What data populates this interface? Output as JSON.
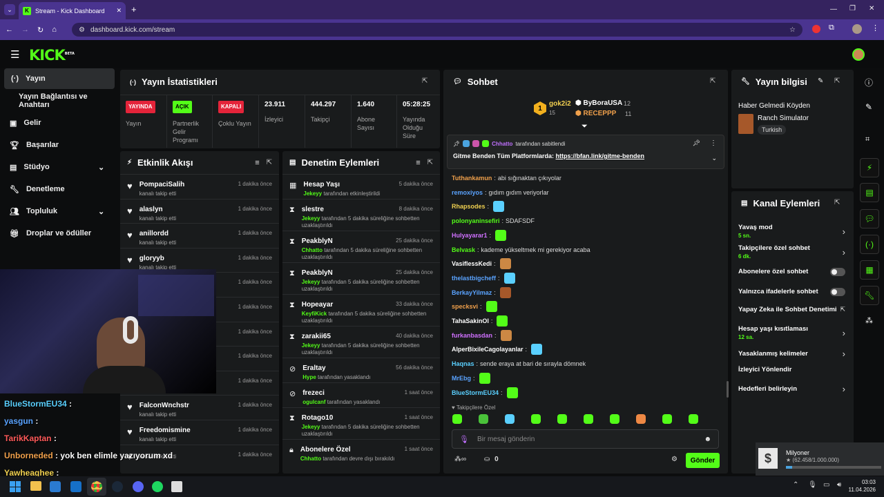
{
  "browser": {
    "tab_title": "Stream - Kick Dashboard",
    "url": "dashboard.kick.com/stream"
  },
  "brand": {
    "logo": "KICK",
    "beta": "BETA"
  },
  "sidebar": {
    "items": [
      {
        "label": "Yayın"
      },
      {
        "label": "Yayın Bağlantısı ve Anahtarı"
      },
      {
        "label": "Gelir"
      },
      {
        "label": "Başarılar"
      },
      {
        "label": "Stüdyo"
      },
      {
        "label": "Denetleme"
      },
      {
        "label": "Topluluk"
      },
      {
        "label": "Droplar ve ödüller"
      }
    ]
  },
  "stats": {
    "title": "Yayın İstatistikleri",
    "cells": [
      {
        "badge": "YAYINDA",
        "label": "Yayın"
      },
      {
        "badge": "AÇIK",
        "label": "Partnerlik Gelir Programı"
      },
      {
        "badge": "KAPALI",
        "label": "Çoklu Yayın"
      },
      {
        "value": "23.911",
        "label": "İzleyici"
      },
      {
        "value": "444.297",
        "label": "Takipçi"
      },
      {
        "value": "1.640",
        "label": "Abone Sayısı"
      },
      {
        "value": "05:28:25",
        "label": "Yayında Olduğu Süre"
      }
    ]
  },
  "activity": {
    "title": "Etkinlik Akışı",
    "items": [
      {
        "name": "PompaciSalih",
        "sub": "kanalı takip etti",
        "time": "1 dakika önce"
      },
      {
        "name": "alaslyn",
        "sub": "kanalı takip etti",
        "time": "1 dakika önce"
      },
      {
        "name": "anillordd",
        "sub": "kanalı takip etti",
        "time": "1 dakika önce"
      },
      {
        "name": "gloryyb",
        "sub": "kanalı takip etti",
        "time": "1 dakika önce"
      },
      {
        "name": "",
        "sub": "",
        "time": "1 dakika önce"
      },
      {
        "name": "",
        "sub": "",
        "time": "1 dakika önce"
      },
      {
        "name": "",
        "sub": "",
        "time": "1 dakika önce"
      },
      {
        "name": "",
        "sub": "",
        "time": "1 dakika önce"
      },
      {
        "name": "",
        "sub": "kanalı takip etti",
        "time": "1 dakika önce"
      },
      {
        "name": "FalconWnchstr",
        "sub": "kanalı takip etti",
        "time": "1 dakika önce"
      },
      {
        "name": "Freedomismine",
        "sub": "kanalı takip etti",
        "time": "1 dakika önce"
      },
      {
        "name": "",
        "sub": "kanalı takip etti",
        "time": "1 dakika önce"
      }
    ]
  },
  "moderation": {
    "title": "Denetim Eylemleri",
    "items": [
      {
        "name": "Hesap Yaşı",
        "actor": "Jekeyy",
        "sub": "tarafından etkinleştirildi",
        "time": "5 dakika önce",
        "icon": "calendar-icon"
      },
      {
        "name": "slestre",
        "actor": "Jekeyy",
        "sub": "tarafından 5 dakika süreliğine sohbetten uzaklaştırıldı",
        "time": "8 dakika önce",
        "icon": "hourglass-icon"
      },
      {
        "name": "PeakblyN",
        "actor": "Chhatto",
        "sub": "tarafından 5 dakika süreliğine sohbetten uzaklaştırıldı",
        "time": "25 dakika önce",
        "icon": "hourglass-icon"
      },
      {
        "name": "PeakblyN",
        "actor": "Jekeyy",
        "sub": "tarafından 5 dakika süreliğine sohbetten uzaklaştırıldı",
        "time": "25 dakika önce",
        "icon": "hourglass-icon"
      },
      {
        "name": "Hopeayar",
        "actor": "KeyfiKick",
        "sub": "tarafından 5 dakika süreliğine sohbetten uzaklaştırıldı",
        "time": "33 dakika önce",
        "icon": "hourglass-icon"
      },
      {
        "name": "zarakii65",
        "actor": "Jekeyy",
        "sub": "tarafından 5 dakika süreliğine sohbetten uzaklaştırıldı",
        "time": "40 dakika önce",
        "icon": "hourglass-icon"
      },
      {
        "name": "Eraltay",
        "actor": "Hype",
        "sub": "tarafından yasaklandı",
        "time": "56 dakika önce",
        "icon": "ban-icon"
      },
      {
        "name": "frezeci",
        "actor": "ogulcanf",
        "sub": "tarafından yasaklandı",
        "time": "1 saat önce",
        "icon": "ban-icon"
      },
      {
        "name": "Rotago10",
        "actor": "Jekeyy",
        "sub": "tarafından 5 dakika süreliğine sohbetten uzaklaştırıldı",
        "time": "1 saat önce",
        "icon": "hourglass-icon"
      },
      {
        "name": "Abonelere Özel",
        "actor": "Chhatto",
        "sub": "tarafından devre dışı bırakıldı",
        "time": "1 saat önce",
        "icon": "lock-icon"
      }
    ]
  },
  "chat": {
    "title": "Sohbet",
    "leaders": {
      "first": {
        "rank": "1",
        "name": "gok2i2",
        "count": "15"
      },
      "second": {
        "name": "ByBoraUSA",
        "count": "12"
      },
      "third": {
        "name": "RECEPPP",
        "count": "11"
      }
    },
    "pinned": {
      "author": "Chhatto",
      "by": "tarafından sabitlendi",
      "text": "Gitme Benden Tüm Platformlarda:",
      "link": "https://bfan.link/gitme-benden"
    },
    "messages": [
      {
        "user": "Tuthankamun",
        "color": "#f0a04b",
        "text": "abi sığınaktan çıkıyolar"
      },
      {
        "user": "remoxiyos",
        "color": "#5aa3ff",
        "text": "gıdım gıdım veriyorlar"
      },
      {
        "user": "Rhapsodes",
        "color": "#f0d050",
        "text": ""
      },
      {
        "user": "polonyaninsefiri",
        "color": "#53fc18",
        "text": "SDAFSDF"
      },
      {
        "user": "Hulyayarar1",
        "color": "#d070ff",
        "text": ""
      },
      {
        "user": "Belvask",
        "color": "#53fc18",
        "text": "kademe yükseltmek mi gerekiyor acaba"
      },
      {
        "user": "VasiflessKedi",
        "color": "#fff",
        "text": ""
      },
      {
        "user": "thelastbigcheff",
        "color": "#5aa3ff",
        "text": ""
      },
      {
        "user": "BerkayYilmaz",
        "color": "#5aa3ff",
        "text": ""
      },
      {
        "user": "specksvi",
        "color": "#f0a04b",
        "text": ""
      },
      {
        "user": "TahaSakinOl",
        "color": "#fff",
        "text": ""
      },
      {
        "user": "furkanbasdan",
        "color": "#d070ff",
        "text": ""
      },
      {
        "user": "AlperBixileCagolayanlar",
        "color": "#fff",
        "text": ""
      },
      {
        "user": "Haqnas",
        "color": "#5ad0ff",
        "text": "sende eraya at bari de sırayla dömnek"
      },
      {
        "user": "MrEbg",
        "color": "#5aa3ff",
        "text": ""
      },
      {
        "user": "BlueStormEU34",
        "color": "#5ad0ff",
        "text": ""
      }
    ],
    "followers_label": "Takipçilere Özel",
    "input_placeholder": "Bir mesaj gönderin",
    "points": "0",
    "send_label": "Gönder"
  },
  "stream_info": {
    "title": "Yayın bilgisi",
    "stream_title": "Haber Gelmedi Köyden",
    "category": "Ranch Simulator",
    "language": "Turkish"
  },
  "channel_actions": {
    "title": "Kanal Eylemleri",
    "items": [
      {
        "label": "Yavaş mod",
        "sub": "5 sn.",
        "control": "chevron"
      },
      {
        "label": "Takipçilere özel sohbet",
        "sub": "6 dk.",
        "control": "chevron"
      },
      {
        "label": "Abonelere özel sohbet",
        "sub": "",
        "control": "toggle"
      },
      {
        "label": "Yalnızca ifadelerle sohbet",
        "sub": "",
        "control": "toggle"
      },
      {
        "label": "Yapay Zeka ile Sohbet Denetimi",
        "sub": "",
        "control": "external"
      },
      {
        "label": "Hesap yaşı kısıtlaması",
        "sub": "12 sa.",
        "control": "chevron"
      },
      {
        "label": "Yasaklanmış kelimeler",
        "sub": "",
        "control": "chevron"
      },
      {
        "label": "İzleyici Yönlendir",
        "sub": "",
        "control": "none"
      },
      {
        "label": "Hedefleri belirleyin",
        "sub": "",
        "control": "chevron"
      }
    ]
  },
  "overlay_chat": [
    {
      "user": "BlueStormEU34",
      "text": ":",
      "color": "#5ad0ff"
    },
    {
      "user": "yasgun",
      "text": ":",
      "color": "#5aa3ff"
    },
    {
      "user": "TarikKaptan",
      "text": ":",
      "color": "#ff5a5a"
    },
    {
      "user": "Unborneded",
      "text": ": yok ben elimle yazıyorum xd",
      "color": "#f0a04b"
    },
    {
      "user": "Yawheaghee",
      "text": ":",
      "color": "#f0d050"
    }
  ],
  "goal_widget": {
    "title": "Milyoner",
    "progress": "(62.458/1.000.000)",
    "fraction": 0.062
  },
  "taskbar": {
    "time": "03:03",
    "date": "11.04.2026"
  }
}
